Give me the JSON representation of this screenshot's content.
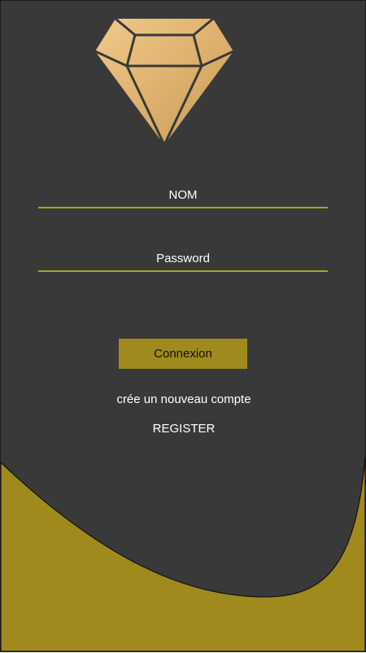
{
  "logo": {
    "icon": "diamond-icon",
    "color": "#e0b36f"
  },
  "form": {
    "name_placeholder": "NOM",
    "password_placeholder": "Password",
    "submit_label": "Connexion"
  },
  "create_account_text": "crée un nouveau compte",
  "register_label": "REGISTER",
  "colors": {
    "background": "#3a3939",
    "accent": "#a08a1e",
    "field_underline": "#a8a424",
    "text": "#ffffff"
  }
}
